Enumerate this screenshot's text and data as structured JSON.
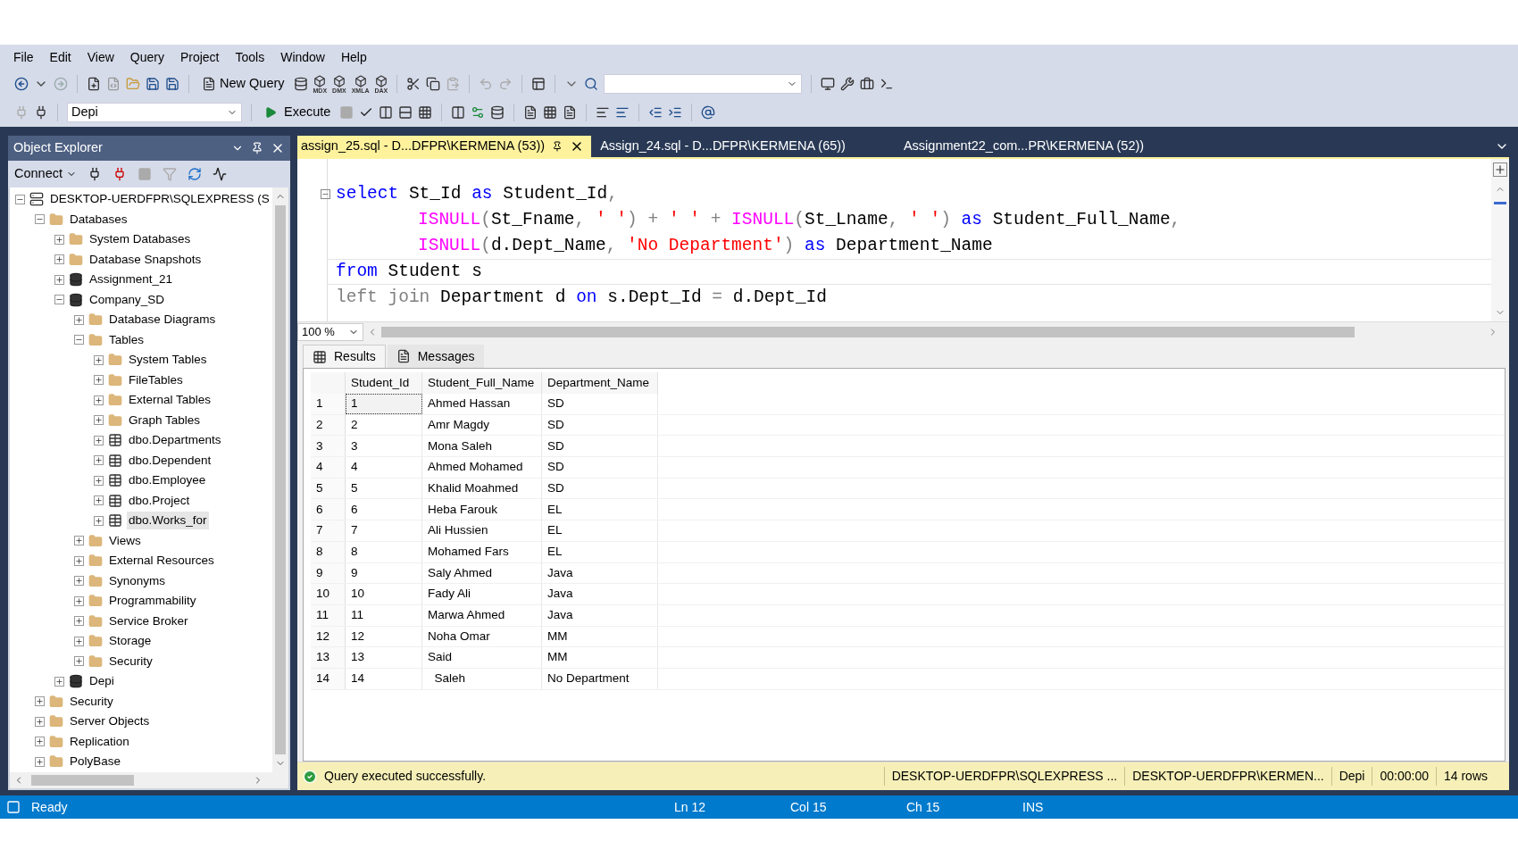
{
  "menu": [
    "File",
    "Edit",
    "View",
    "Query",
    "Project",
    "Tools",
    "Window",
    "Help"
  ],
  "toolbar": {
    "new_query": "New Query",
    "query_types": [
      "MDX",
      "DMX",
      "XMLA",
      "DAX"
    ],
    "database": "Depi",
    "execute": "Execute"
  },
  "object_explorer": {
    "title": "Object Explorer",
    "connect": "Connect",
    "tree": [
      {
        "label": "DESKTOP-UERDFPR\\SQLEXPRESS (S",
        "kind": "server",
        "expanded": true,
        "selected": false,
        "children": [
          {
            "label": "Databases",
            "kind": "folder",
            "expanded": true,
            "selected": false,
            "children": [
              {
                "label": "System Databases",
                "kind": "folder",
                "expanded": false,
                "selected": false
              },
              {
                "label": "Database Snapshots",
                "kind": "folder",
                "expanded": false,
                "selected": false
              },
              {
                "label": "Assignment_21",
                "kind": "database",
                "expanded": false,
                "selected": false
              },
              {
                "label": "Company_SD",
                "kind": "database",
                "expanded": true,
                "selected": false,
                "children": [
                  {
                    "label": "Database Diagrams",
                    "kind": "folder",
                    "expanded": false,
                    "selected": false
                  },
                  {
                    "label": "Tables",
                    "kind": "folder",
                    "expanded": true,
                    "selected": false,
                    "children": [
                      {
                        "label": "System Tables",
                        "kind": "folder",
                        "expanded": false,
                        "selected": false
                      },
                      {
                        "label": "FileTables",
                        "kind": "folder",
                        "expanded": false,
                        "selected": false
                      },
                      {
                        "label": "External Tables",
                        "kind": "folder",
                        "expanded": false,
                        "selected": false
                      },
                      {
                        "label": "Graph Tables",
                        "kind": "folder",
                        "expanded": false,
                        "selected": false
                      },
                      {
                        "label": "dbo.Departments",
                        "kind": "table",
                        "expanded": false,
                        "selected": false
                      },
                      {
                        "label": "dbo.Dependent",
                        "kind": "table",
                        "expanded": false,
                        "selected": false
                      },
                      {
                        "label": "dbo.Employee",
                        "kind": "table",
                        "expanded": false,
                        "selected": false
                      },
                      {
                        "label": "dbo.Project",
                        "kind": "table",
                        "expanded": false,
                        "selected": false
                      },
                      {
                        "label": "dbo.Works_for",
                        "kind": "table",
                        "expanded": false,
                        "selected": true
                      }
                    ]
                  },
                  {
                    "label": "Views",
                    "kind": "folder",
                    "expanded": false,
                    "selected": false
                  },
                  {
                    "label": "External Resources",
                    "kind": "folder",
                    "expanded": false,
                    "selected": false
                  },
                  {
                    "label": "Synonyms",
                    "kind": "folder",
                    "expanded": false,
                    "selected": false
                  },
                  {
                    "label": "Programmability",
                    "kind": "folder",
                    "expanded": false,
                    "selected": false
                  },
                  {
                    "label": "Service Broker",
                    "kind": "folder",
                    "expanded": false,
                    "selected": false
                  },
                  {
                    "label": "Storage",
                    "kind": "folder",
                    "expanded": false,
                    "selected": false
                  },
                  {
                    "label": "Security",
                    "kind": "folder",
                    "expanded": false,
                    "selected": false
                  }
                ]
              },
              {
                "label": "Depi",
                "kind": "database",
                "expanded": false,
                "selected": false
              }
            ]
          },
          {
            "label": "Security",
            "kind": "folder",
            "expanded": false,
            "selected": false
          },
          {
            "label": "Server Objects",
            "kind": "folder",
            "expanded": false,
            "selected": false
          },
          {
            "label": "Replication",
            "kind": "folder",
            "expanded": false,
            "selected": false
          },
          {
            "label": "PolyBase",
            "kind": "folder",
            "expanded": false,
            "selected": false
          }
        ]
      }
    ]
  },
  "editor": {
    "tabs": [
      {
        "label": "assign_25.sql - D...DFPR\\KERMENA (53))",
        "selected": true
      },
      {
        "label": "Assign_24.sql - D...DFPR\\KERMENA (65))",
        "selected": false
      },
      {
        "label": "Assignment22_com...PR\\KERMENA (52))",
        "selected": false
      }
    ],
    "lines": [
      {
        "kind": "statement",
        "current": false,
        "tokens": [
          {
            "kind": "keyword",
            "t": "select"
          },
          {
            "kind": "plain",
            "t": " St_Id "
          },
          {
            "kind": "keyword",
            "t": "as"
          },
          {
            "kind": "plain",
            "t": " Student_Id"
          },
          {
            "kind": "operator",
            "t": ","
          }
        ]
      },
      {
        "kind": "continuation",
        "current": false,
        "tokens": [
          {
            "kind": "function",
            "t": "ISNULL"
          },
          {
            "kind": "operator",
            "t": "("
          },
          {
            "kind": "plain",
            "t": "St_Fname"
          },
          {
            "kind": "operator",
            "t": ", "
          },
          {
            "kind": "string",
            "t": "' '"
          },
          {
            "kind": "operator",
            "t": ") + "
          },
          {
            "kind": "string",
            "t": "' '"
          },
          {
            "kind": "operator",
            "t": " + "
          },
          {
            "kind": "function",
            "t": "ISNULL"
          },
          {
            "kind": "operator",
            "t": "("
          },
          {
            "kind": "plain",
            "t": "St_Lname"
          },
          {
            "kind": "operator",
            "t": ", "
          },
          {
            "kind": "string",
            "t": "' '"
          },
          {
            "kind": "operator",
            "t": ") "
          },
          {
            "kind": "keyword",
            "t": "as"
          },
          {
            "kind": "plain",
            "t": " Student_Full_Name"
          },
          {
            "kind": "operator",
            "t": ","
          }
        ]
      },
      {
        "kind": "continuation",
        "current": false,
        "tokens": [
          {
            "kind": "function",
            "t": "ISNULL"
          },
          {
            "kind": "operator",
            "t": "("
          },
          {
            "kind": "plain",
            "t": "d.Dept_Name"
          },
          {
            "kind": "operator",
            "t": ", "
          },
          {
            "kind": "string",
            "t": "'No Department'"
          },
          {
            "kind": "operator",
            "t": ") "
          },
          {
            "kind": "keyword",
            "t": "as"
          },
          {
            "kind": "plain",
            "t": " Department_Name"
          }
        ]
      },
      {
        "kind": "statement",
        "current": true,
        "tokens": [
          {
            "kind": "keyword",
            "t": "from"
          },
          {
            "kind": "plain",
            "t": " Student s"
          }
        ]
      },
      {
        "kind": "statement",
        "current": false,
        "tokens": [
          {
            "kind": "operator",
            "t": "left join"
          },
          {
            "kind": "plain",
            "t": " Department d "
          },
          {
            "kind": "keyword",
            "t": "on"
          },
          {
            "kind": "plain",
            "t": " s.Dept_Id "
          },
          {
            "kind": "operator",
            "t": "="
          },
          {
            "kind": "plain",
            "t": " d.Dept_Id"
          }
        ]
      }
    ],
    "zoom": "100 %"
  },
  "results": {
    "tabs": [
      {
        "label": "Results",
        "selected": true
      },
      {
        "label": "Messages",
        "selected": false
      }
    ],
    "columns": [
      "Student_Id",
      "Student_Full_Name",
      "Department_Name"
    ],
    "rows": [
      {
        "number": "1",
        "selected": true,
        "cells": [
          "1",
          "Ahmed Hassan",
          "SD"
        ]
      },
      {
        "number": "2",
        "selected": false,
        "cells": [
          "2",
          "Amr Magdy",
          "SD"
        ]
      },
      {
        "number": "3",
        "selected": false,
        "cells": [
          "3",
          "Mona Saleh",
          "SD"
        ]
      },
      {
        "number": "4",
        "selected": false,
        "cells": [
          "4",
          "Ahmed Mohamed",
          "SD"
        ]
      },
      {
        "number": "5",
        "selected": false,
        "cells": [
          "5",
          "Khalid Moahmed",
          "SD"
        ]
      },
      {
        "number": "6",
        "selected": false,
        "cells": [
          "6",
          "Heba Farouk",
          "EL"
        ]
      },
      {
        "number": "7",
        "selected": false,
        "cells": [
          "7",
          "Ali Hussien",
          "EL"
        ]
      },
      {
        "number": "8",
        "selected": false,
        "cells": [
          "8",
          "Mohamed Fars",
          "EL"
        ]
      },
      {
        "number": "9",
        "selected": false,
        "cells": [
          "9",
          "Saly Ahmed",
          "Java"
        ]
      },
      {
        "number": "10",
        "selected": false,
        "cells": [
          "10",
          "Fady Ali",
          "Java"
        ]
      },
      {
        "number": "11",
        "selected": false,
        "cells": [
          "11",
          "Marwa Ahmed",
          "Java"
        ]
      },
      {
        "number": "12",
        "selected": false,
        "cells": [
          "12",
          "Noha Omar",
          "MM"
        ]
      },
      {
        "number": "13",
        "selected": false,
        "cells": [
          "13",
          "Said",
          "MM"
        ]
      },
      {
        "number": "14",
        "selected": false,
        "cells": [
          "14",
          "  Saleh",
          "No Department"
        ]
      }
    ],
    "status": {
      "message": "Query executed successfully.",
      "items": [
        "DESKTOP-UERDFPR\\SQLEXPRESS ...",
        "DESKTOP-UERDFPR\\KERMEN...",
        "Depi",
        "00:00:00",
        "14 rows"
      ]
    }
  },
  "status_bar": {
    "state": "Ready",
    "items": [
      "Ln 12",
      "Col 15",
      "Ch 15",
      "INS"
    ]
  }
}
